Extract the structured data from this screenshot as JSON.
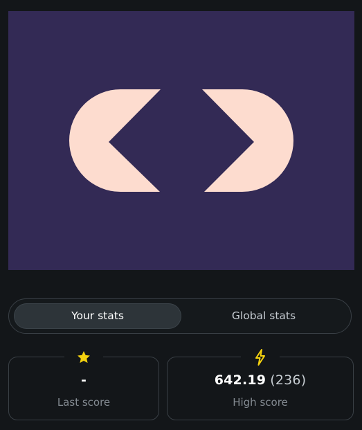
{
  "thumbnail": {
    "background_color": "#332a55",
    "logo_color": "#fddccf",
    "logo_icon": "angle-brackets-logo-icon"
  },
  "tabs": [
    {
      "label": "Your stats",
      "active": true
    },
    {
      "label": "Global stats",
      "active": false
    }
  ],
  "stats": {
    "last_score": {
      "icon": "star-icon",
      "value": "-",
      "label": "Last score"
    },
    "high_score": {
      "icon": "lightning-icon",
      "value": "642.19",
      "rank": "(236)",
      "label": "High score"
    }
  },
  "colors": {
    "accent_yellow": "#f5d20f",
    "background": "#131619",
    "border": "#3a4046"
  }
}
